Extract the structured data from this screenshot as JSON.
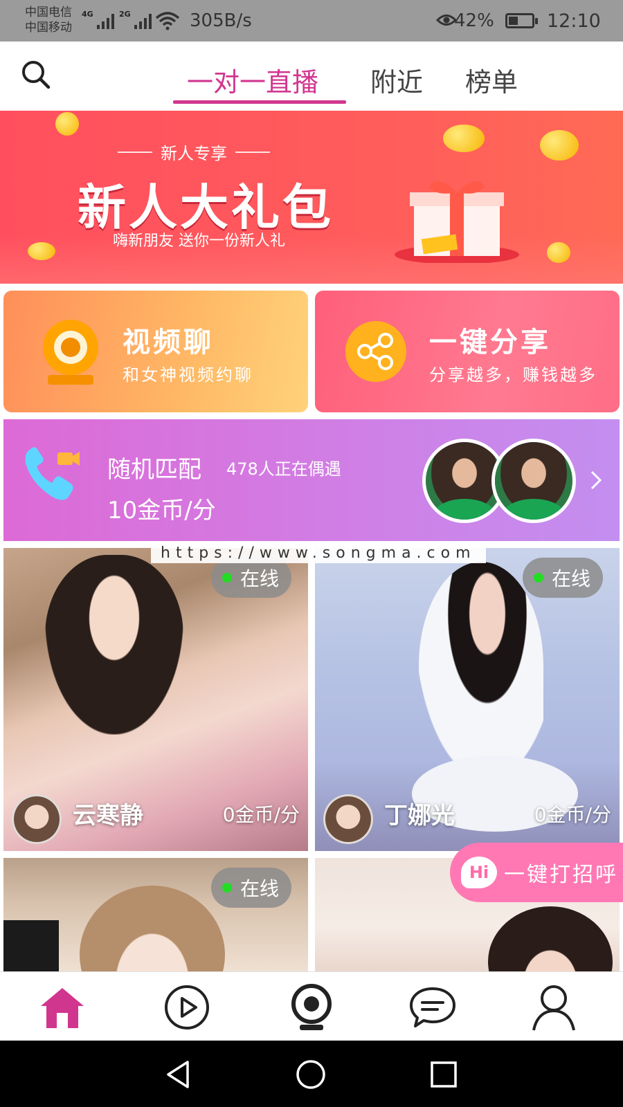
{
  "status_bar": {
    "carrier_1": "中国电信",
    "carrier_2": "中国移动",
    "net_1": "4G",
    "net_2": "2G",
    "speed": "305B/s",
    "battery": "42%",
    "battery_level": 0.42,
    "time": "12:10"
  },
  "top_nav": {
    "tabs": [
      {
        "label": "一对一直播",
        "active": true
      },
      {
        "label": "附近",
        "active": false
      },
      {
        "label": "榜单",
        "active": false
      }
    ],
    "accent": "#d1368f"
  },
  "banner": {
    "kicker": "新人专享",
    "title": "新人大礼包",
    "subtitle": "嗨新朋友 送你一份新人礼"
  },
  "features": [
    {
      "title": "视频聊",
      "subtitle": "和女神视频约聊",
      "icon": "webcam-icon"
    },
    {
      "title": "一键分享",
      "subtitle": "分享越多，赚钱越多",
      "icon": "share-icon"
    }
  ],
  "random_match": {
    "title": "随机匹配",
    "count_text": "478人正在偶遇",
    "price": "10金币/分"
  },
  "watermark": "https://www.songma.com",
  "hosts": [
    {
      "status": "在线",
      "name": "云寒静",
      "price": "0金币/分"
    },
    {
      "status": "在线",
      "name": "丁娜光",
      "price": "0金币/分"
    },
    {
      "status": "在线",
      "name": "",
      "price": ""
    },
    {
      "status": "",
      "name": "",
      "price": ""
    }
  ],
  "greet_button": {
    "badge": "Hi",
    "label": "一键打招呼"
  },
  "bottom_nav": {
    "items": [
      {
        "icon": "home-icon",
        "active": true
      },
      {
        "icon": "play-icon",
        "active": false
      },
      {
        "icon": "webcam-icon",
        "active": false
      },
      {
        "icon": "chat-bubble-icon",
        "active": false
      },
      {
        "icon": "profile-icon",
        "active": false
      }
    ]
  },
  "system_nav": [
    "back-icon",
    "home-circle-icon",
    "recents-icon"
  ]
}
